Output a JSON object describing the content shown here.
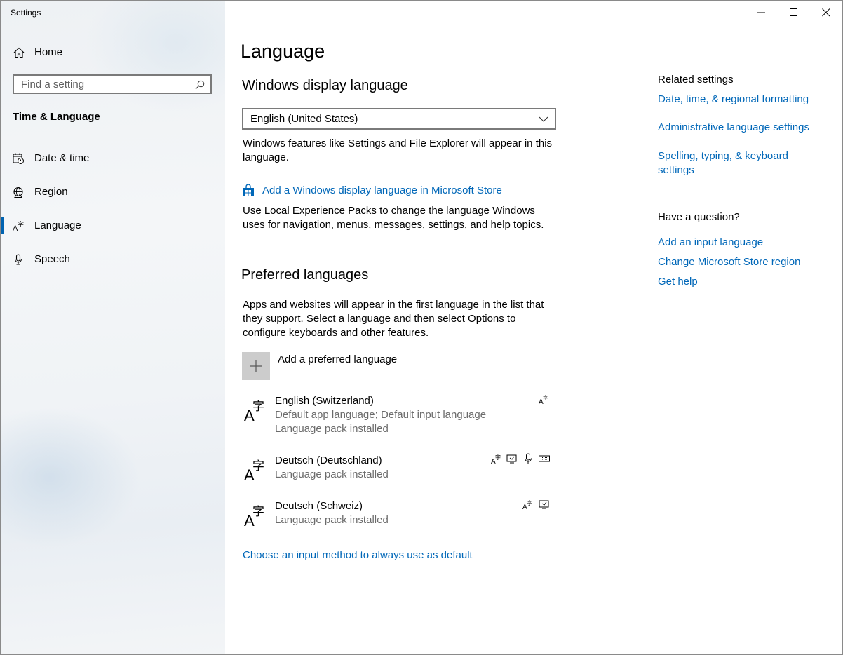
{
  "window": {
    "title": "Settings"
  },
  "controls": {
    "minimize": "minimize-icon",
    "maximize": "maximize-icon",
    "close": "close-icon"
  },
  "sidebar": {
    "home_label": "Home",
    "search_placeholder": "Find a setting",
    "section_title": "Time & Language",
    "items": [
      {
        "label": "Date & time",
        "icon": "calendar-clock-icon"
      },
      {
        "label": "Region",
        "icon": "globe-icon"
      },
      {
        "label": "Language",
        "icon": "language-icon",
        "active": true
      },
      {
        "label": "Speech",
        "icon": "microphone-icon"
      }
    ]
  },
  "main": {
    "title": "Language",
    "display_language": {
      "heading": "Windows display language",
      "selected": "English (United States)",
      "description": "Windows features like Settings and File Explorer will appear in this language.",
      "store_link": "Add a Windows display language in Microsoft Store",
      "store_description": "Use Local Experience Packs to change the language Windows uses for navigation, menus, messages, settings, and help topics."
    },
    "preferred": {
      "heading": "Preferred languages",
      "description": "Apps and websites will appear in the first language in the list that they support. Select a language and then select Options to configure keyboards and other features.",
      "add_label": "Add a preferred language",
      "languages": [
        {
          "name": "English (Switzerland)",
          "line1": "Default app language; Default input language",
          "line2": "Language pack installed",
          "features": [
            "display-language-icon"
          ]
        },
        {
          "name": "Deutsch (Deutschland)",
          "line1": "Language pack installed",
          "features": [
            "display-language-icon",
            "text-to-speech-icon",
            "speech-recognition-icon",
            "keyboard-icon"
          ]
        },
        {
          "name": "Deutsch (Schweiz)",
          "line1": "Language pack installed",
          "features": [
            "display-language-icon",
            "text-to-speech-icon"
          ]
        }
      ],
      "input_method_link": "Choose an input method to always use as default"
    }
  },
  "related": {
    "heading": "Related settings",
    "links": [
      "Date, time, & regional formatting",
      "Administrative language settings",
      "Spelling, typing, & keyboard settings"
    ],
    "question_heading": "Have a question?",
    "help_links": [
      "Add an input language",
      "Change Microsoft Store region",
      "Get help"
    ]
  },
  "colors": {
    "accent": "#0067b8",
    "active_indicator": "#0063b1",
    "secondary_text": "#6b6b6b"
  }
}
